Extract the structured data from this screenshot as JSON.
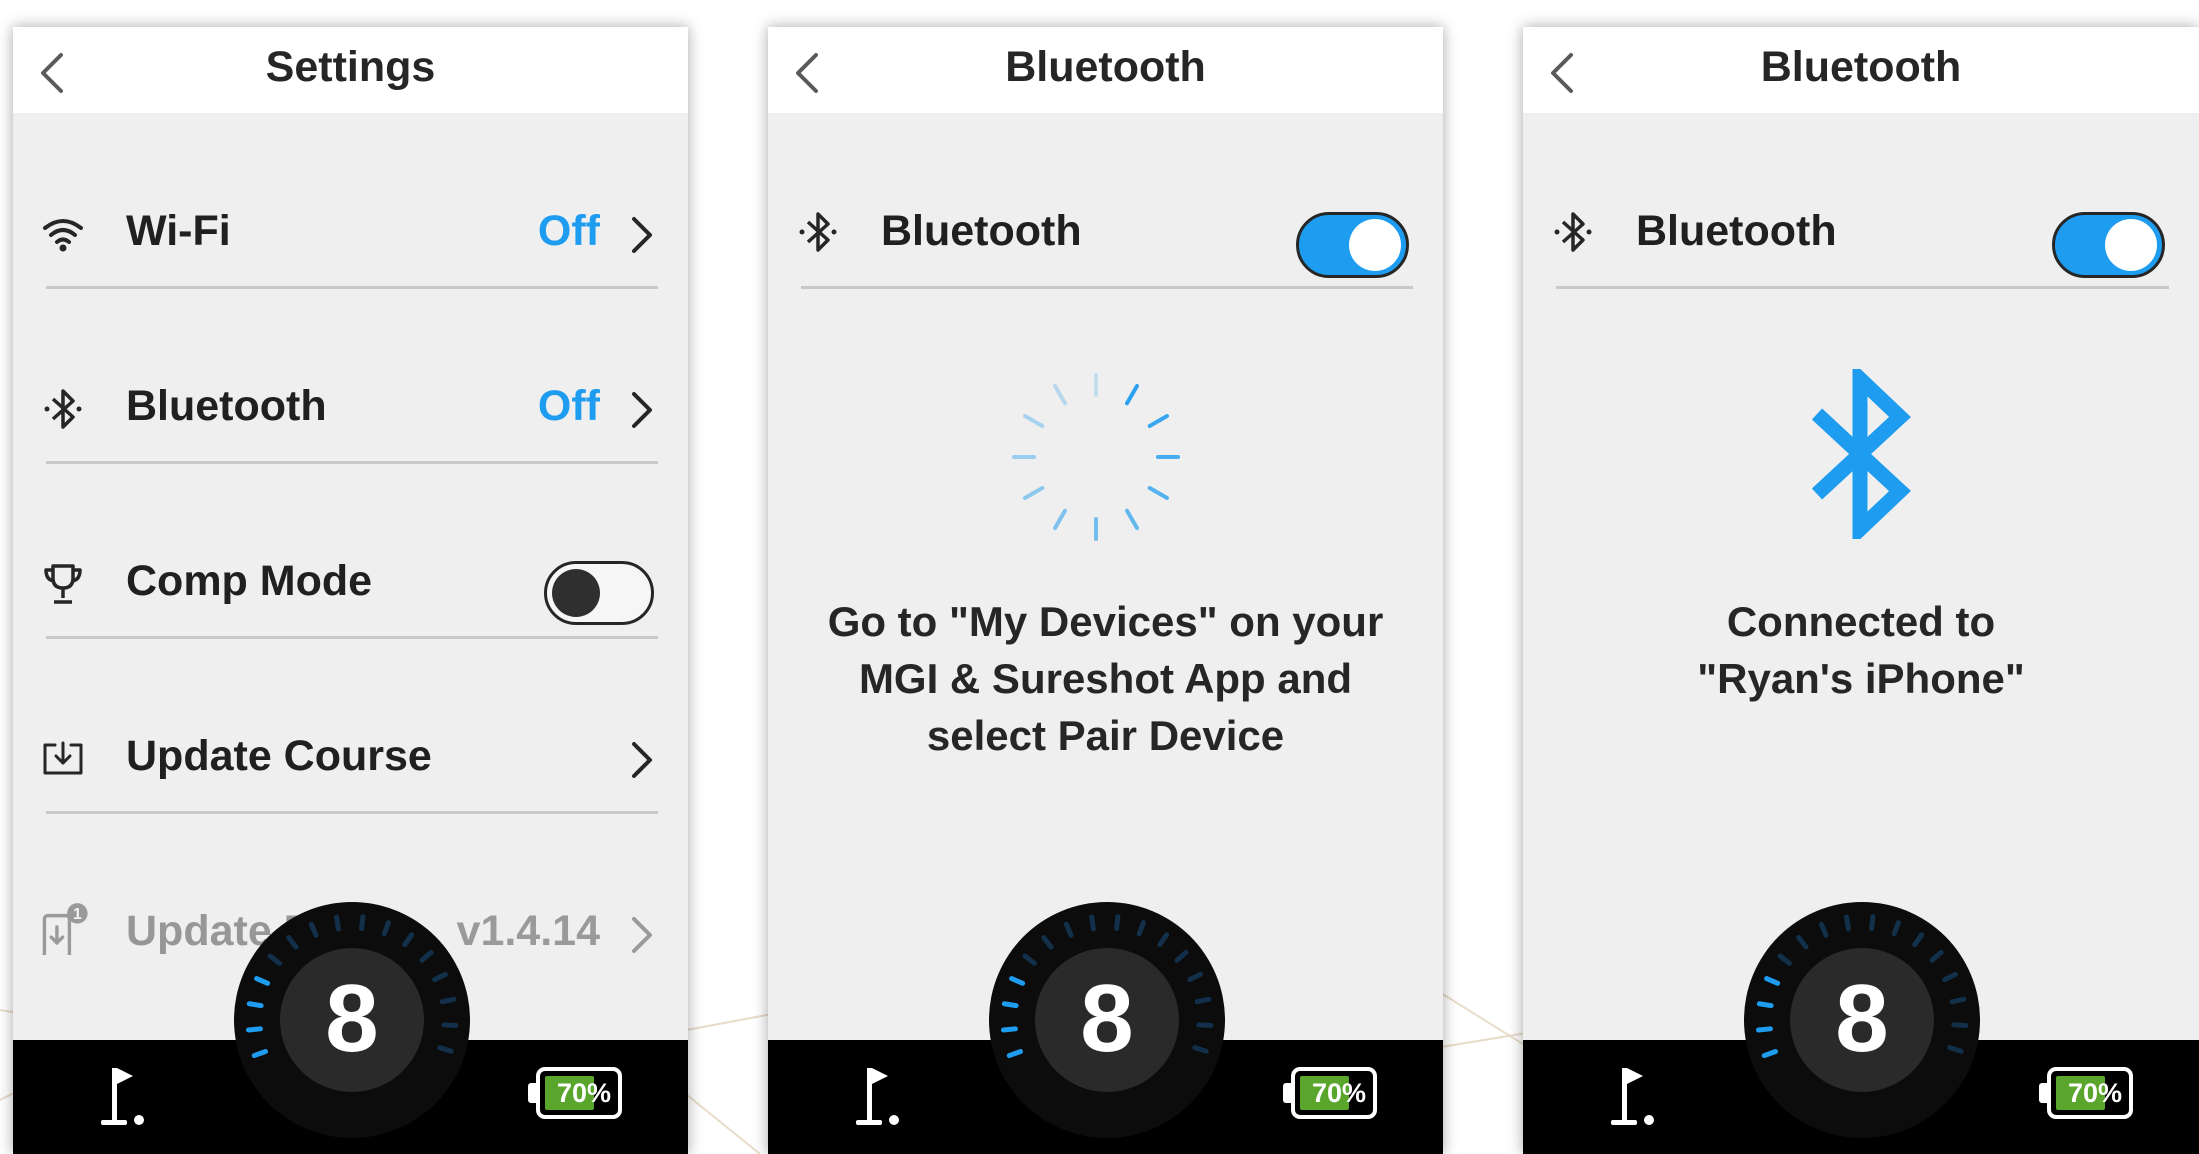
{
  "colors": {
    "accent": "#1e9cf0",
    "battery_fill": "#5aa52c",
    "bar": "#000000"
  },
  "screens": [
    {
      "title": "Settings",
      "rows": [
        {
          "label": "Wi-Fi",
          "value": "Off",
          "icon": "wifi-icon"
        },
        {
          "label": "Bluetooth",
          "value": "Off",
          "icon": "bluetooth-icon"
        },
        {
          "label": "Comp Mode",
          "icon": "trophy-icon",
          "toggle": "off"
        },
        {
          "label": "Update Course",
          "icon": "download-icon"
        },
        {
          "label": "Update Device",
          "value": "v1.4.14",
          "icon": "device-update-icon",
          "badge": "1",
          "disabled": true
        }
      ],
      "dial_number": "8",
      "battery": "70%",
      "battery_level": 0.7
    },
    {
      "title": "Bluetooth",
      "toggle_row": {
        "label": "Bluetooth",
        "toggle": "on"
      },
      "message_lines": [
        "Go to \"My Devices\" on your",
        "MGI & Sureshot App and",
        "select Pair Device"
      ],
      "dial_number": "8",
      "battery": "70%",
      "battery_level": 0.7
    },
    {
      "title": "Bluetooth",
      "toggle_row": {
        "label": "Bluetooth",
        "toggle": "on"
      },
      "message_lines": [
        "Connected to",
        "\"Ryan's iPhone\""
      ],
      "dial_number": "8",
      "battery": "70%",
      "battery_level": 0.7
    }
  ]
}
